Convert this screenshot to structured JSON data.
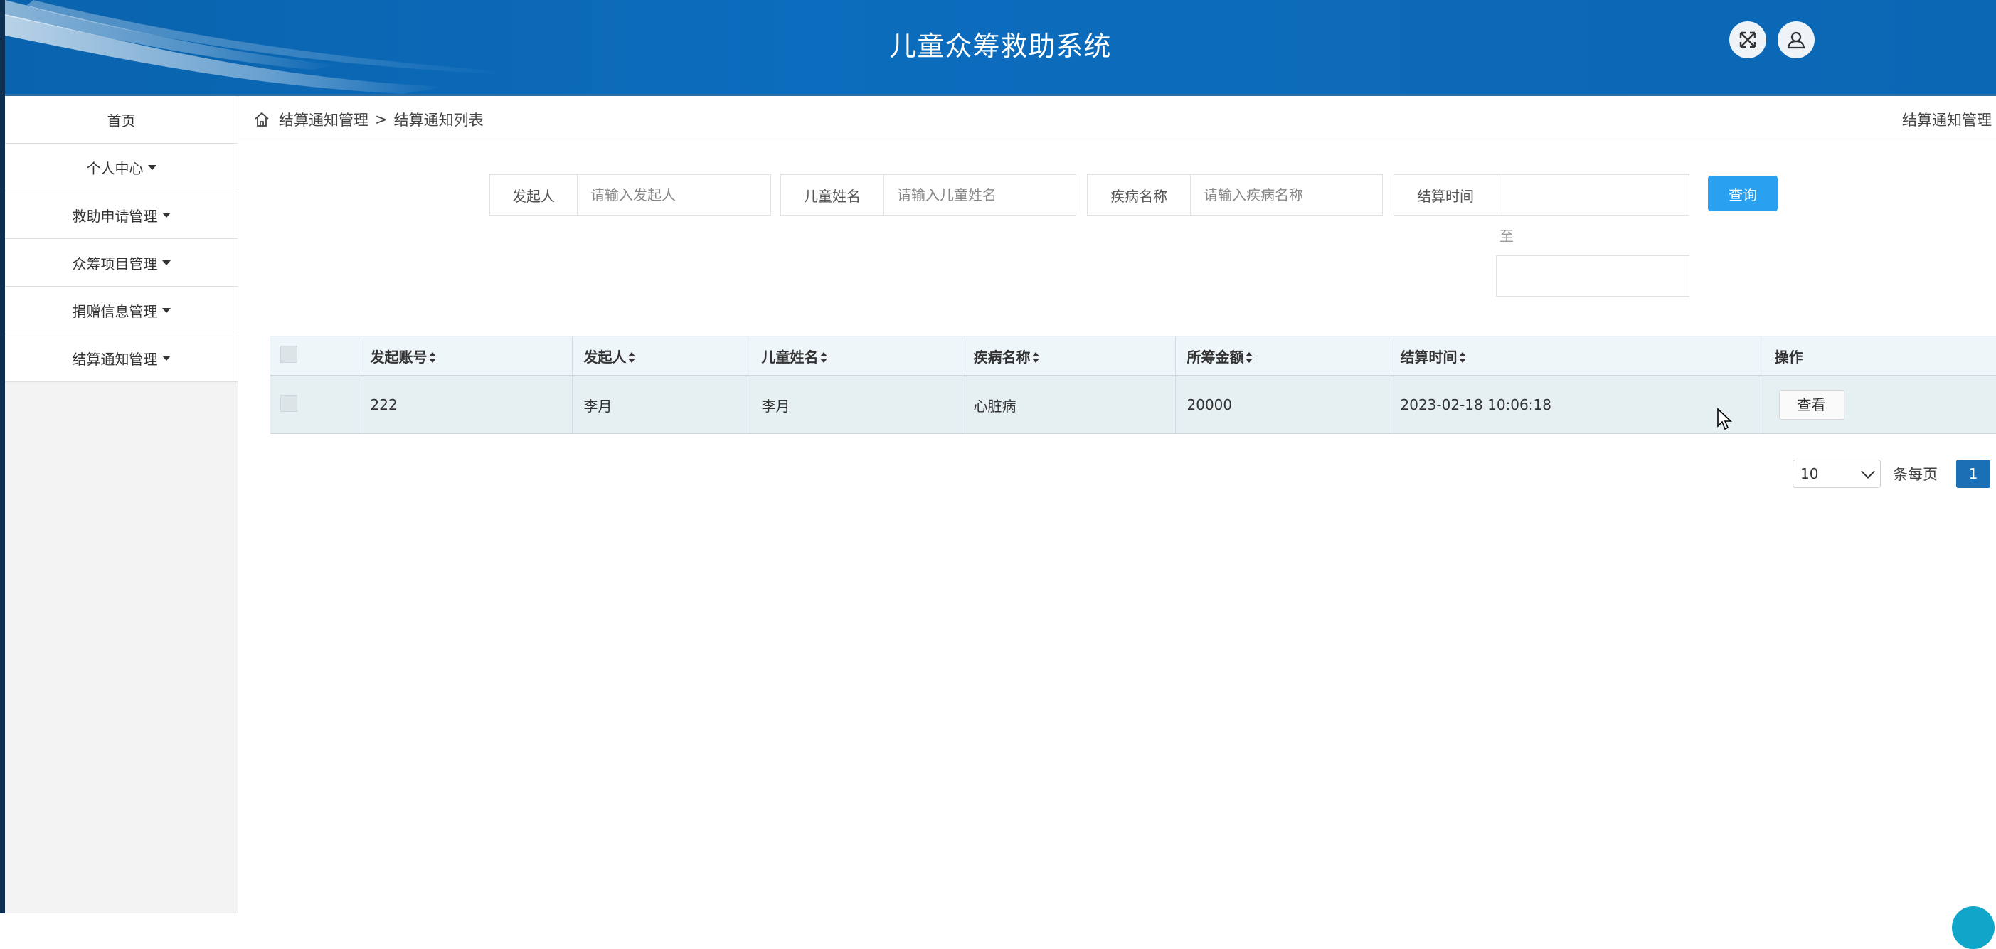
{
  "header": {
    "title": "儿童众筹救助系统",
    "fullscreen_icon": "expand-arrows-icon",
    "user_icon": "user-icon"
  },
  "sidebar": {
    "items": [
      {
        "label": "首页",
        "dropdown": false
      },
      {
        "label": "个人中心",
        "dropdown": true
      },
      {
        "label": "救助申请管理",
        "dropdown": true
      },
      {
        "label": "众筹项目管理",
        "dropdown": true
      },
      {
        "label": "捐赠信息管理",
        "dropdown": true
      },
      {
        "label": "结算通知管理",
        "dropdown": true
      }
    ]
  },
  "breadcrumb": {
    "icon": "home-icon",
    "parent": "结算通知管理",
    "separator": ">",
    "current": "结算通知列表",
    "right_label": "结算通知管理"
  },
  "search": {
    "initiator_label": "发起人",
    "initiator_placeholder": "请输入发起人",
    "child_name_label": "儿童姓名",
    "child_name_placeholder": "请输入儿童姓名",
    "disease_label": "疾病名称",
    "disease_placeholder": "请输入疾病名称",
    "settle_time_label": "结算时间",
    "to_label": "至",
    "query_button": "查询"
  },
  "table": {
    "columns": [
      "发起账号",
      "发起人",
      "儿童姓名",
      "疾病名称",
      "所筹金额",
      "结算时间",
      "操作"
    ],
    "rows": [
      {
        "account": "222",
        "initiator": "李月",
        "child_name": "李月",
        "disease": "心脏病",
        "amount": "20000",
        "settle_time": "2023-02-18 10:06:18",
        "action": "查看"
      }
    ]
  },
  "pagination": {
    "page_size": "10",
    "per_page_label": "条每页",
    "current_page": "1"
  },
  "colors": {
    "header_blue": "#0b67b4",
    "query_button": "#2aa0f0",
    "page_active": "#1b6fb4"
  }
}
